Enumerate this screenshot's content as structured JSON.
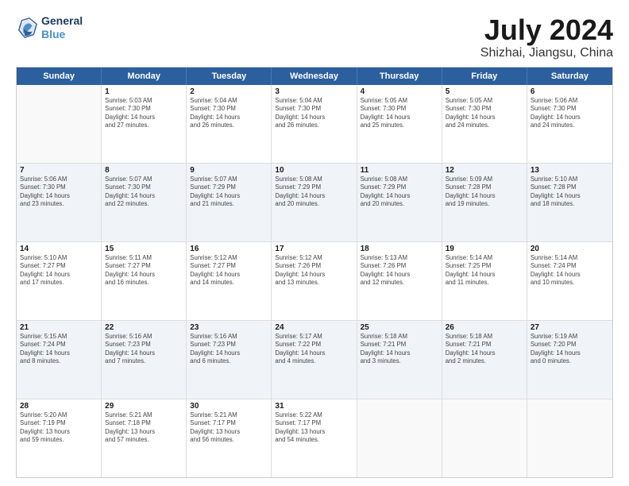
{
  "logo": {
    "line1": "General",
    "line2": "Blue"
  },
  "title": "July 2024",
  "subtitle": "Shizhai, Jiangsu, China",
  "header_days": [
    "Sunday",
    "Monday",
    "Tuesday",
    "Wednesday",
    "Thursday",
    "Friday",
    "Saturday"
  ],
  "rows": [
    {
      "alt": false,
      "cells": [
        {
          "day": "",
          "info": "",
          "empty": true
        },
        {
          "day": "1",
          "info": "Sunrise: 5:03 AM\nSunset: 7:30 PM\nDaylight: 14 hours\nand 27 minutes."
        },
        {
          "day": "2",
          "info": "Sunrise: 5:04 AM\nSunset: 7:30 PM\nDaylight: 14 hours\nand 26 minutes."
        },
        {
          "day": "3",
          "info": "Sunrise: 5:04 AM\nSunset: 7:30 PM\nDaylight: 14 hours\nand 26 minutes."
        },
        {
          "day": "4",
          "info": "Sunrise: 5:05 AM\nSunset: 7:30 PM\nDaylight: 14 hours\nand 25 minutes."
        },
        {
          "day": "5",
          "info": "Sunrise: 5:05 AM\nSunset: 7:30 PM\nDaylight: 14 hours\nand 24 minutes."
        },
        {
          "day": "6",
          "info": "Sunrise: 5:06 AM\nSunset: 7:30 PM\nDaylight: 14 hours\nand 24 minutes."
        }
      ]
    },
    {
      "alt": true,
      "cells": [
        {
          "day": "7",
          "info": "Sunrise: 5:06 AM\nSunset: 7:30 PM\nDaylight: 14 hours\nand 23 minutes."
        },
        {
          "day": "8",
          "info": "Sunrise: 5:07 AM\nSunset: 7:30 PM\nDaylight: 14 hours\nand 22 minutes."
        },
        {
          "day": "9",
          "info": "Sunrise: 5:07 AM\nSunset: 7:29 PM\nDaylight: 14 hours\nand 21 minutes."
        },
        {
          "day": "10",
          "info": "Sunrise: 5:08 AM\nSunset: 7:29 PM\nDaylight: 14 hours\nand 20 minutes."
        },
        {
          "day": "11",
          "info": "Sunrise: 5:08 AM\nSunset: 7:29 PM\nDaylight: 14 hours\nand 20 minutes."
        },
        {
          "day": "12",
          "info": "Sunrise: 5:09 AM\nSunset: 7:28 PM\nDaylight: 14 hours\nand 19 minutes."
        },
        {
          "day": "13",
          "info": "Sunrise: 5:10 AM\nSunset: 7:28 PM\nDaylight: 14 hours\nand 18 minutes."
        }
      ]
    },
    {
      "alt": false,
      "cells": [
        {
          "day": "14",
          "info": "Sunrise: 5:10 AM\nSunset: 7:27 PM\nDaylight: 14 hours\nand 17 minutes."
        },
        {
          "day": "15",
          "info": "Sunrise: 5:11 AM\nSunset: 7:27 PM\nDaylight: 14 hours\nand 16 minutes."
        },
        {
          "day": "16",
          "info": "Sunrise: 5:12 AM\nSunset: 7:27 PM\nDaylight: 14 hours\nand 14 minutes."
        },
        {
          "day": "17",
          "info": "Sunrise: 5:12 AM\nSunset: 7:26 PM\nDaylight: 14 hours\nand 13 minutes."
        },
        {
          "day": "18",
          "info": "Sunrise: 5:13 AM\nSunset: 7:26 PM\nDaylight: 14 hours\nand 12 minutes."
        },
        {
          "day": "19",
          "info": "Sunrise: 5:14 AM\nSunset: 7:25 PM\nDaylight: 14 hours\nand 11 minutes."
        },
        {
          "day": "20",
          "info": "Sunrise: 5:14 AM\nSunset: 7:24 PM\nDaylight: 14 hours\nand 10 minutes."
        }
      ]
    },
    {
      "alt": true,
      "cells": [
        {
          "day": "21",
          "info": "Sunrise: 5:15 AM\nSunset: 7:24 PM\nDaylight: 14 hours\nand 8 minutes."
        },
        {
          "day": "22",
          "info": "Sunrise: 5:16 AM\nSunset: 7:23 PM\nDaylight: 14 hours\nand 7 minutes."
        },
        {
          "day": "23",
          "info": "Sunrise: 5:16 AM\nSunset: 7:23 PM\nDaylight: 14 hours\nand 6 minutes."
        },
        {
          "day": "24",
          "info": "Sunrise: 5:17 AM\nSunset: 7:22 PM\nDaylight: 14 hours\nand 4 minutes."
        },
        {
          "day": "25",
          "info": "Sunrise: 5:18 AM\nSunset: 7:21 PM\nDaylight: 14 hours\nand 3 minutes."
        },
        {
          "day": "26",
          "info": "Sunrise: 5:18 AM\nSunset: 7:21 PM\nDaylight: 14 hours\nand 2 minutes."
        },
        {
          "day": "27",
          "info": "Sunrise: 5:19 AM\nSunset: 7:20 PM\nDaylight: 14 hours\nand 0 minutes."
        }
      ]
    },
    {
      "alt": false,
      "cells": [
        {
          "day": "28",
          "info": "Sunrise: 5:20 AM\nSunset: 7:19 PM\nDaylight: 13 hours\nand 59 minutes."
        },
        {
          "day": "29",
          "info": "Sunrise: 5:21 AM\nSunset: 7:18 PM\nDaylight: 13 hours\nand 57 minutes."
        },
        {
          "day": "30",
          "info": "Sunrise: 5:21 AM\nSunset: 7:17 PM\nDaylight: 13 hours\nand 56 minutes."
        },
        {
          "day": "31",
          "info": "Sunrise: 5:22 AM\nSunset: 7:17 PM\nDaylight: 13 hours\nand 54 minutes."
        },
        {
          "day": "",
          "info": "",
          "empty": true
        },
        {
          "day": "",
          "info": "",
          "empty": true
        },
        {
          "day": "",
          "info": "",
          "empty": true
        }
      ]
    }
  ]
}
